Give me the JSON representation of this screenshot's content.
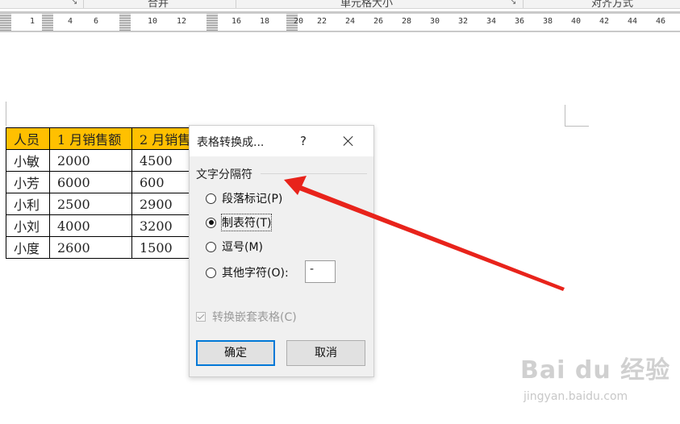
{
  "ribbon": {
    "groups": [
      "合并",
      "单元格大小",
      "对齐方式"
    ]
  },
  "ruler": {
    "ticks": [
      "1",
      "4",
      "6",
      "10",
      "12",
      "16",
      "18",
      "20",
      "22",
      "24",
      "26",
      "28",
      "30",
      "32",
      "34",
      "36",
      "38",
      "40",
      "42",
      "44",
      "46"
    ]
  },
  "table": {
    "headers": [
      "人员",
      "1 月销售额",
      "2 月销售"
    ],
    "rows": [
      [
        "小敏",
        "2000",
        "4500"
      ],
      [
        "小芳",
        "6000",
        "600"
      ],
      [
        "小利",
        "2500",
        "2900"
      ],
      [
        "小刘",
        "4000",
        "3200"
      ],
      [
        "小度",
        "2600",
        "1500"
      ]
    ],
    "header_color": "#ffc000"
  },
  "dialog": {
    "title": "表格转换成...",
    "help": "?",
    "close_icon": "close-icon",
    "group_label": "文字分隔符",
    "options": [
      {
        "label": "段落标记(P)",
        "selected": false
      },
      {
        "label": "制表符(T)",
        "selected": true
      },
      {
        "label": "逗号(M)",
        "selected": false
      },
      {
        "label": "其他字符(O):",
        "selected": false
      }
    ],
    "other_value": "-",
    "nested_label": "转换嵌套表格(C)",
    "ok_label": "确定",
    "cancel_label": "取消",
    "accent_color": "#0078d7"
  },
  "annotation": {
    "arrow_color": "#e8231b",
    "arrow_icon": "red-arrow-icon"
  },
  "watermark": {
    "logo": "Bai du 经验",
    "url": "jingyan.baidu.com"
  }
}
